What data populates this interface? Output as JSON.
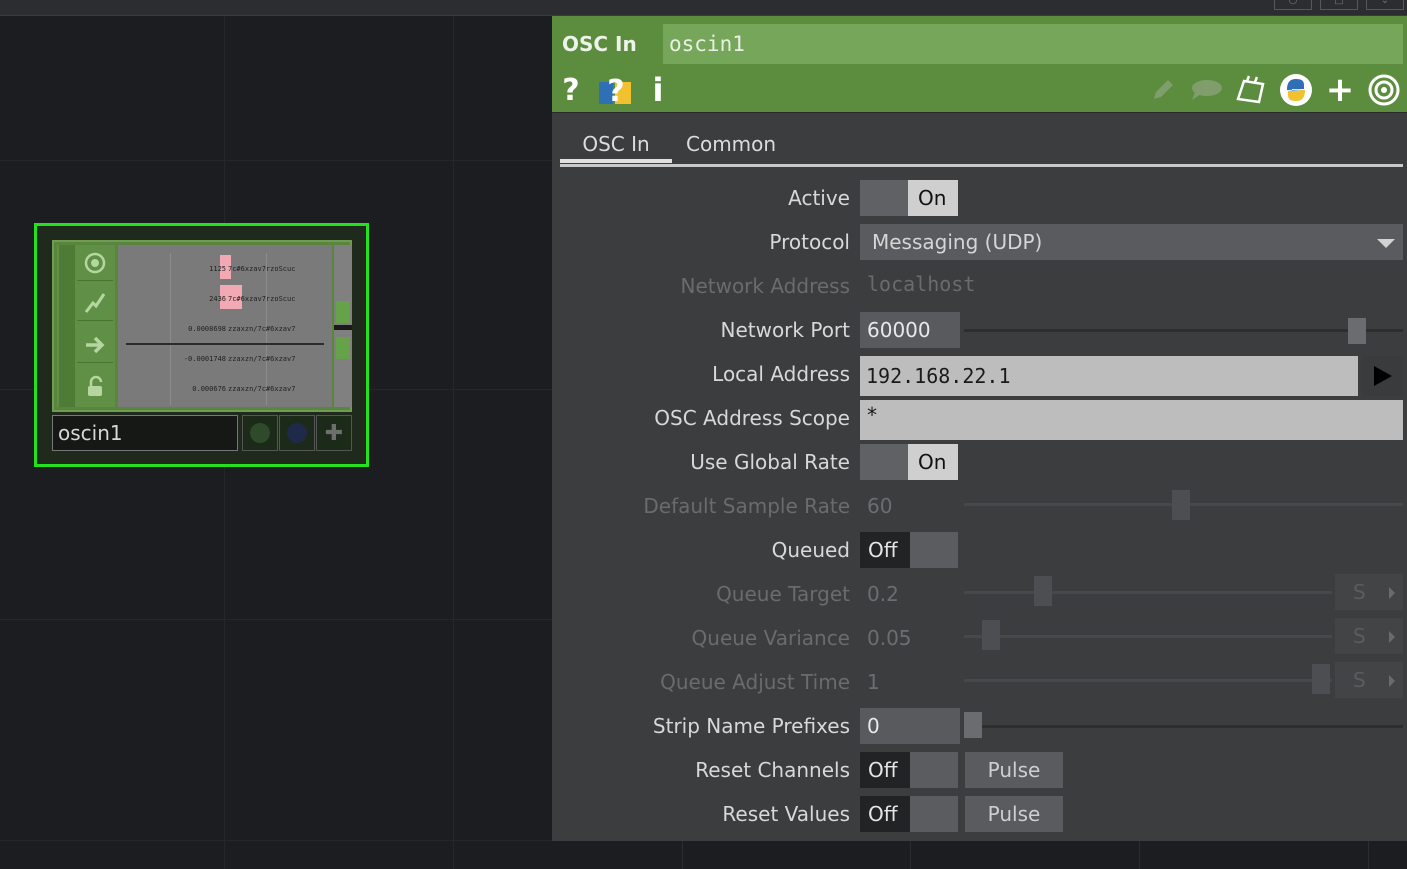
{
  "network": {
    "node": {
      "name": "oscin1",
      "viewer_rows": [
        {
          "value": "1125",
          "channel": "7c#6xzav7rzoScuc"
        },
        {
          "value": "2436",
          "channel": "7c#6xzav7rzoScuc"
        },
        {
          "value": "0.0008698",
          "channel": "zzaxzn/7c#6xzav7"
        },
        {
          "value": "-0.0001748",
          "channel": "zzaxzn/7c#6xzav7"
        },
        {
          "value": "0.000676",
          "channel": "zzaxzn/7c#6xzav7"
        }
      ],
      "flag_colors": [
        "#2f4a2a",
        "#1f2a4a"
      ]
    }
  },
  "panel": {
    "op_type": "OSC In",
    "op_name": "oscin1",
    "header_icons": [
      "help-icon",
      "python-help-icon",
      "info-icon",
      "edit-icon",
      "comment-icon",
      "clone-icon",
      "python-icon",
      "add-icon",
      "viewer-icon"
    ],
    "tabs": [
      {
        "label": "OSC In",
        "active": true
      },
      {
        "label": "Common",
        "active": false
      }
    ],
    "params": {
      "active": {
        "label": "Active",
        "value": "On"
      },
      "protocol": {
        "label": "Protocol",
        "value": "Messaging (UDP)"
      },
      "network_address": {
        "label": "Network Address",
        "value": "localhost"
      },
      "network_port": {
        "label": "Network Port",
        "value": "60000"
      },
      "local_address": {
        "label": "Local Address",
        "value": "192.168.22.1"
      },
      "osc_address_scope": {
        "label": "OSC Address Scope",
        "value": "*"
      },
      "use_global_rate": {
        "label": "Use Global Rate",
        "value": "On"
      },
      "default_sample_rate": {
        "label": "Default Sample Rate",
        "value": "60"
      },
      "queued": {
        "label": "Queued",
        "value": "Off"
      },
      "queue_target": {
        "label": "Queue Target",
        "value": "0.2",
        "unit": "S"
      },
      "queue_variance": {
        "label": "Queue Variance",
        "value": "0.05",
        "unit": "S"
      },
      "queue_adjust_time": {
        "label": "Queue Adjust Time",
        "value": "1",
        "unit": "S"
      },
      "strip_name_prefixes": {
        "label": "Strip Name Prefixes",
        "value": "0"
      },
      "reset_channels": {
        "label": "Reset Channels",
        "value": "Off",
        "pulse": "Pulse"
      },
      "reset_values": {
        "label": "Reset Values",
        "value": "Off",
        "pulse": "Pulse"
      }
    }
  }
}
